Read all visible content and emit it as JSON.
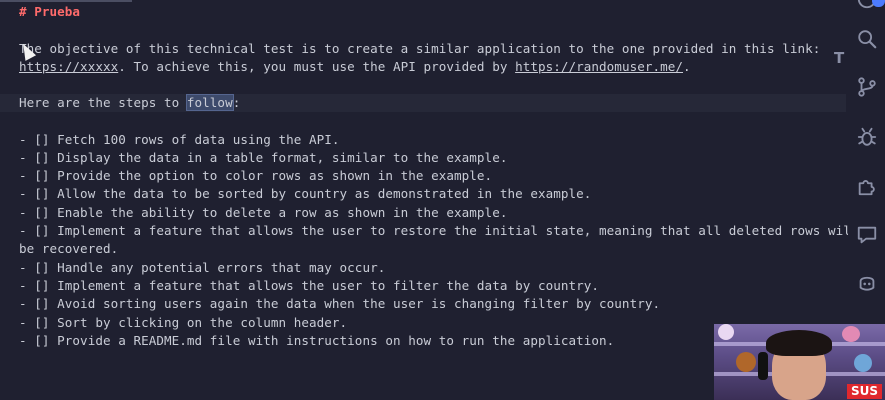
{
  "editor": {
    "heading": "# Prueba",
    "intro": {
      "line1": "The objective of this technical test is to create a similar application to the one provided in this link:",
      "link1": "https://xxxxx",
      "mid": ". To achieve this, you must use the API provided by ",
      "link2": "https://randomuser.me/",
      "end": "."
    },
    "steps_intro": {
      "before": "Here are the steps to ",
      "selected": "follo",
      "caret_char": "w",
      "after": ":"
    },
    "tasks": [
      "- [] Fetch 100 rows of data using the API.",
      "- [] Display the data in a table format, similar to the example.",
      "- [] Provide the option to color rows as shown in the example.",
      "- [] Allow the data to be sorted by country as demonstrated in the example.",
      "- [] Enable the ability to delete a row as shown in the example.",
      "- [] Implement a feature that allows the user to restore the initial state, meaning that all deleted rows will",
      "be recovered.",
      "- [] Handle any potential errors that may occur.",
      "- [] Implement a feature that allows the user to filter the data by country.",
      "- [] Avoid sorting users again the data when the user is changing filter by country.",
      "- [] Sort by clicking on the column header.",
      "- [] Provide a README.md file with instructions on how to run the application."
    ],
    "side_glyph": "T"
  },
  "activity_bar": {
    "icons": [
      "accounts-icon",
      "search-icon",
      "source-control-icon",
      "debug-icon",
      "extensions-icon",
      "chat-icon",
      "copilot-icon"
    ]
  },
  "webcam": {
    "badge": "SUS"
  }
}
